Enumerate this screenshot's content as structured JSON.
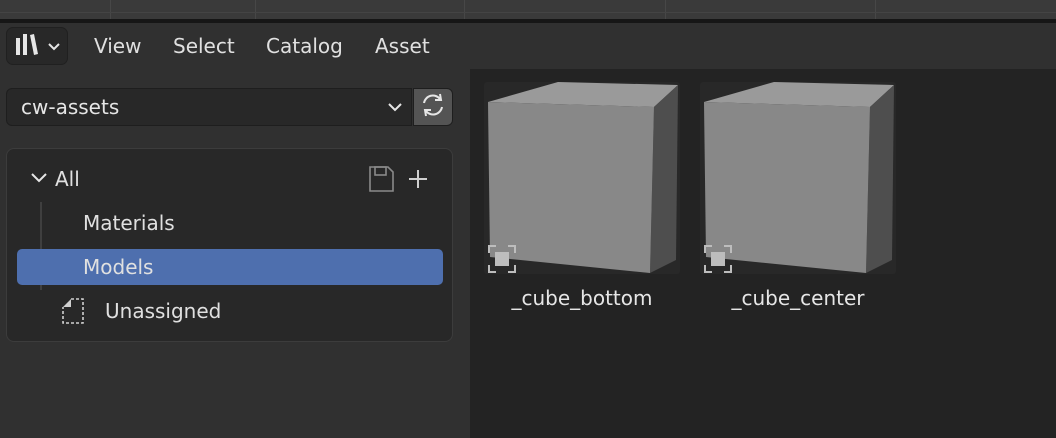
{
  "menu": {
    "editor_type_icon": "asset-browser-icon",
    "items": [
      "View",
      "Select",
      "Catalog",
      "Asset"
    ]
  },
  "library": {
    "selected": "cw-assets",
    "refresh_icon": "refresh-icon"
  },
  "catalogs": {
    "root": "All",
    "children": [
      "Materials",
      "Models"
    ],
    "selected": "Models",
    "unassigned": "Unassigned",
    "save_icon": "save-icon",
    "add_icon": "plus-icon"
  },
  "assets": [
    {
      "name": "_cube_bottom",
      "type_icon": "object-data-icon"
    },
    {
      "name": "_cube_center",
      "type_icon": "object-data-icon"
    }
  ],
  "colors": {
    "selection": "#4e6fae",
    "panel": "#282828",
    "asset_area": "#232323"
  }
}
